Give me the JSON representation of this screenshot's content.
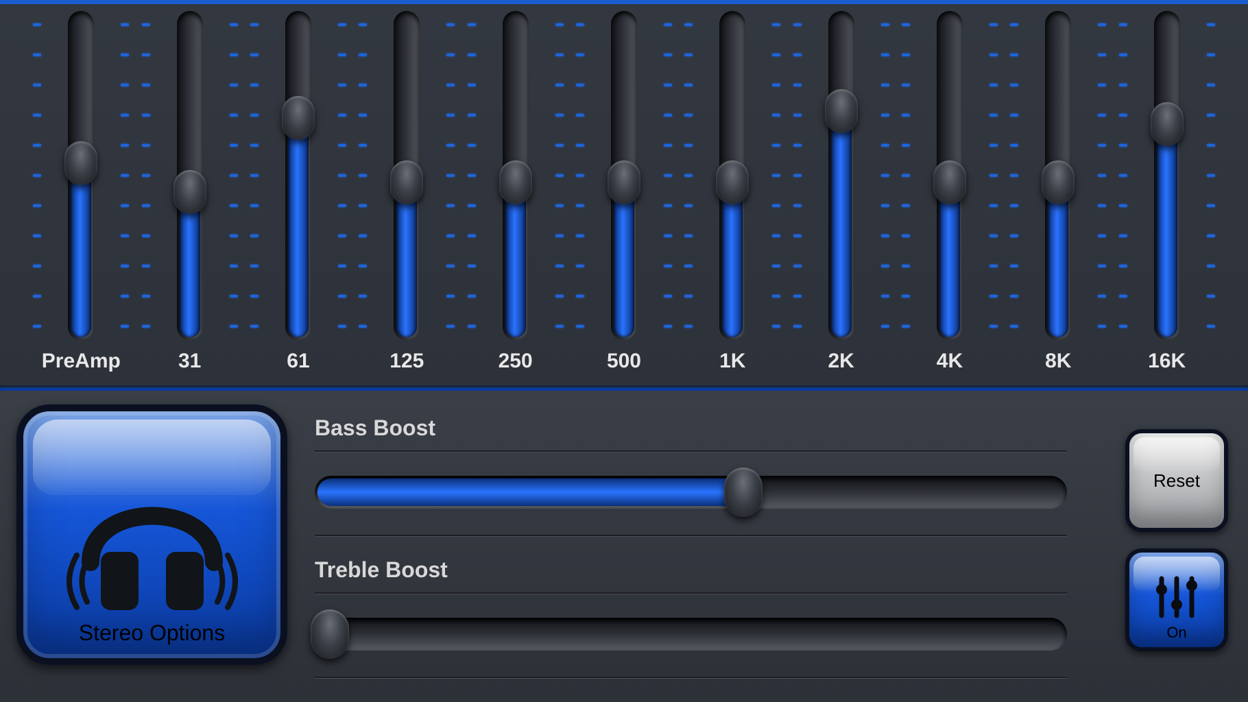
{
  "colors": {
    "accent": "#1a5dce",
    "fill": "#2a73ff"
  },
  "eq": {
    "bands": [
      {
        "label": "PreAmp",
        "value": 56
      },
      {
        "label": "31",
        "value": 47
      },
      {
        "label": "61",
        "value": 70
      },
      {
        "label": "125",
        "value": 50
      },
      {
        "label": "250",
        "value": 50
      },
      {
        "label": "500",
        "value": 50
      },
      {
        "label": "1K",
        "value": 50
      },
      {
        "label": "2K",
        "value": 72
      },
      {
        "label": "4K",
        "value": 50
      },
      {
        "label": "8K",
        "value": 50
      },
      {
        "label": "16K",
        "value": 68
      }
    ]
  },
  "stereo": {
    "label": "Stereo Options"
  },
  "boost": {
    "bass": {
      "label": "Bass Boost",
      "value": 57
    },
    "treble": {
      "label": "Treble Boost",
      "value": 2
    }
  },
  "buttons": {
    "reset": {
      "label": "Reset"
    },
    "on": {
      "label": "On"
    }
  }
}
